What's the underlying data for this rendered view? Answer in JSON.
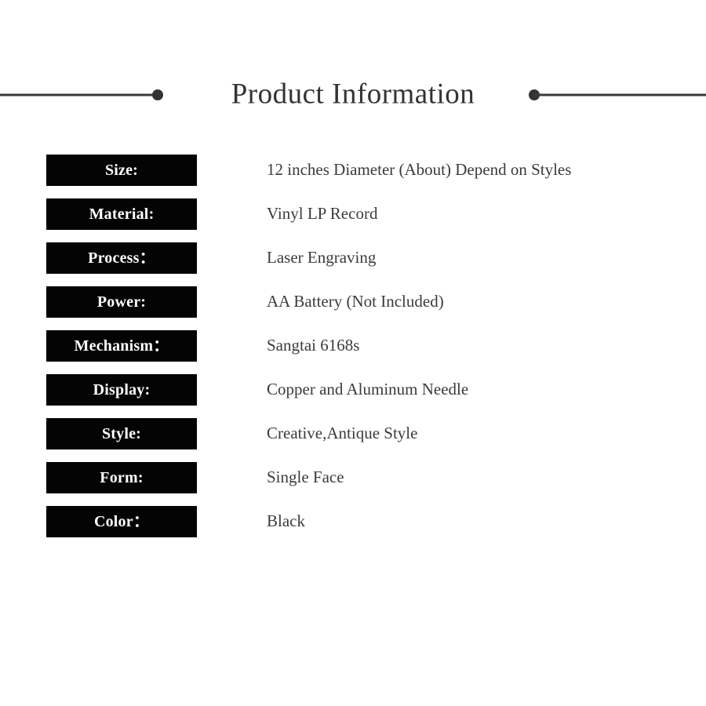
{
  "header": {
    "title": "Product Information",
    "rule_color": "#3a3a3a",
    "dot_color": "#333333"
  },
  "spec_table": {
    "label_background": "#040404",
    "label_color": "#ffffff",
    "value_color": "#3b3b3b",
    "rows": [
      {
        "label": "Size:",
        "value": "12 inches Diameter (About) Depend on Styles"
      },
      {
        "label": "Material:",
        "value": "Vinyl LP Record"
      },
      {
        "label": "Process：",
        "value": "Laser Engraving"
      },
      {
        "label": "Power:",
        "value": "AA Battery (Not Included)"
      },
      {
        "label": "Mechanism：",
        "value": "Sangtai 6168s"
      },
      {
        "label": "Display:",
        "value": "Copper and Aluminum Needle"
      },
      {
        "label": "Style:",
        "value": "Creative,Antique Style"
      },
      {
        "label": "Form:",
        "value": "Single Face"
      },
      {
        "label": "Color：",
        "value": "Black"
      }
    ]
  },
  "page": {
    "background": "#ffffff"
  }
}
